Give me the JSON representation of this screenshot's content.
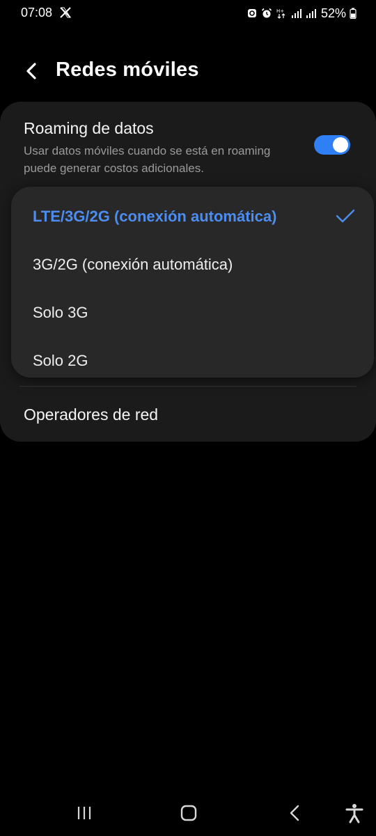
{
  "status_bar": {
    "time": "07:08",
    "battery": "52%",
    "icons": [
      "x-app-icon",
      "recycle-icon",
      "alarm-icon",
      "data-arrows-icon",
      "signal-icon",
      "signal-icon",
      "battery-icon"
    ]
  },
  "header": {
    "back_icon": "chevron-left-icon",
    "title": "Redes móviles"
  },
  "roaming": {
    "title": "Roaming de datos",
    "description": "Usar datos móviles cuando se está en roaming puede generar costos adicionales.",
    "enabled": true
  },
  "network_mode_menu": {
    "options": [
      {
        "label": "LTE/3G/2G (conexión automática)",
        "selected": true
      },
      {
        "label": "3G/2G (conexión automática)",
        "selected": false
      },
      {
        "label": "Solo 3G",
        "selected": false
      },
      {
        "label": "Solo 2G",
        "selected": false
      }
    ]
  },
  "operators": {
    "label": "Operadores de red"
  },
  "nav_bar": {
    "buttons": [
      "recents-icon",
      "home-icon",
      "back-icon",
      "accessibility-icon"
    ]
  },
  "colors": {
    "background": "#000000",
    "card": "#1b1b1b",
    "popup": "#282828",
    "accent": "#4d8df0",
    "toggle_on": "#2f7ff5",
    "secondary_text": "#9a9a9a"
  }
}
